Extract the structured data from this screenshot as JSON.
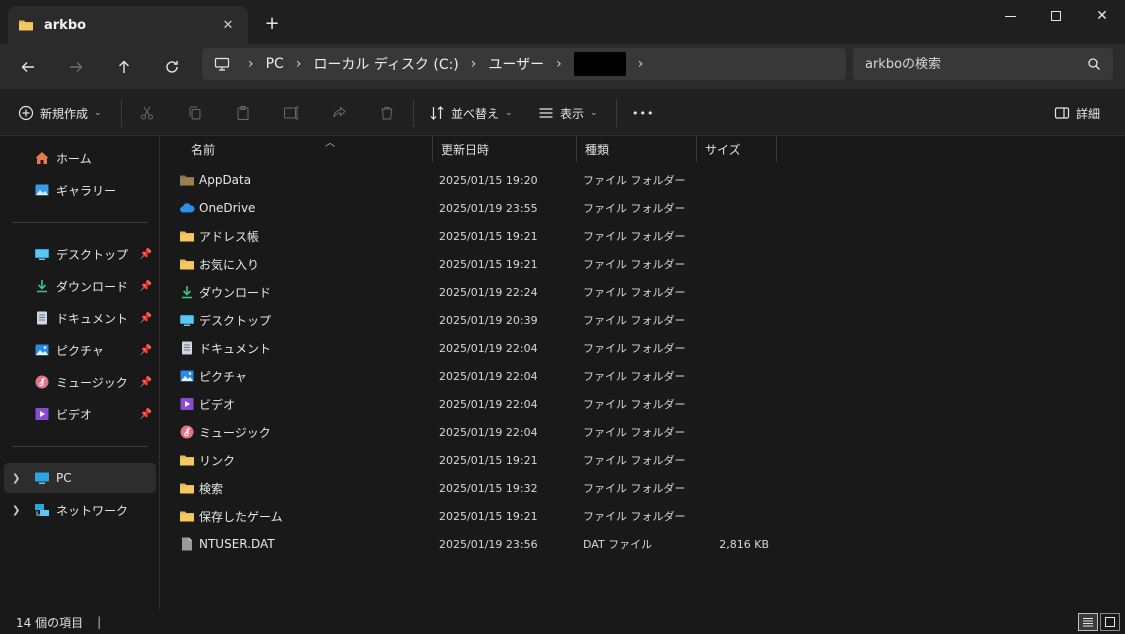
{
  "window": {
    "tab_title": "arkbo",
    "new_tab": "+",
    "close_tab": "✕",
    "minimize": "—",
    "maximize": "☐",
    "close": "✕"
  },
  "address": {
    "crumbs": [
      "PC",
      "ローカル ディスク (C:)",
      "ユーザー"
    ],
    "search_placeholder": "arkboの検索"
  },
  "toolbar": {
    "new_label": "新規作成",
    "sort_label": "並べ替え",
    "view_label": "表示",
    "more_label": "•••",
    "details_label": "詳細"
  },
  "nav": {
    "quick": [
      {
        "label": "ホーム",
        "icon": "home-icon"
      },
      {
        "label": "ギャラリー",
        "icon": "gallery-icon"
      }
    ],
    "pinned": [
      {
        "label": "デスクトップ",
        "icon": "desktop-icon"
      },
      {
        "label": "ダウンロード",
        "icon": "download-icon"
      },
      {
        "label": "ドキュメント",
        "icon": "document-icon"
      },
      {
        "label": "ピクチャ",
        "icon": "pictures-icon"
      },
      {
        "label": "ミュージック",
        "icon": "music-icon"
      },
      {
        "label": "ビデオ",
        "icon": "video-icon"
      }
    ],
    "tree": [
      {
        "label": "PC",
        "icon": "pc-icon"
      },
      {
        "label": "ネットワーク",
        "icon": "network-icon"
      }
    ]
  },
  "columns": {
    "name": "名前",
    "modified": "更新日時",
    "type": "種類",
    "size": "サイズ"
  },
  "files": [
    {
      "name": "AppData",
      "modified": "2025/01/15 19:20",
      "type": "ファイル フォルダー",
      "size": "",
      "icon": "folder-dim-icon"
    },
    {
      "name": "OneDrive",
      "modified": "2025/01/19 23:55",
      "type": "ファイル フォルダー",
      "size": "",
      "icon": "onedrive-icon"
    },
    {
      "name": "アドレス帳",
      "modified": "2025/01/15 19:21",
      "type": "ファイル フォルダー",
      "size": "",
      "icon": "folder-icon"
    },
    {
      "name": "お気に入り",
      "modified": "2025/01/15 19:21",
      "type": "ファイル フォルダー",
      "size": "",
      "icon": "folder-icon"
    },
    {
      "name": "ダウンロード",
      "modified": "2025/01/19 22:24",
      "type": "ファイル フォルダー",
      "size": "",
      "icon": "download-icon"
    },
    {
      "name": "デスクトップ",
      "modified": "2025/01/19 20:39",
      "type": "ファイル フォルダー",
      "size": "",
      "icon": "desktop-icon"
    },
    {
      "name": "ドキュメント",
      "modified": "2025/01/19 22:04",
      "type": "ファイル フォルダー",
      "size": "",
      "icon": "document-icon"
    },
    {
      "name": "ピクチャ",
      "modified": "2025/01/19 22:04",
      "type": "ファイル フォルダー",
      "size": "",
      "icon": "pictures-icon"
    },
    {
      "name": "ビデオ",
      "modified": "2025/01/19 22:04",
      "type": "ファイル フォルダー",
      "size": "",
      "icon": "video-icon"
    },
    {
      "name": "ミュージック",
      "modified": "2025/01/19 22:04",
      "type": "ファイル フォルダー",
      "size": "",
      "icon": "music-icon"
    },
    {
      "name": "リンク",
      "modified": "2025/01/15 19:21",
      "type": "ファイル フォルダー",
      "size": "",
      "icon": "folder-icon"
    },
    {
      "name": "検索",
      "modified": "2025/01/15 19:32",
      "type": "ファイル フォルダー",
      "size": "",
      "icon": "folder-icon"
    },
    {
      "name": "保存したゲーム",
      "modified": "2025/01/15 19:21",
      "type": "ファイル フォルダー",
      "size": "",
      "icon": "folder-icon"
    },
    {
      "name": "NTUSER.DAT",
      "modified": "2025/01/19 23:56",
      "type": "DAT ファイル",
      "size": "2,816 KB",
      "icon": "file-icon"
    }
  ],
  "status": {
    "count": "14 個の項目",
    "cursor": "|"
  },
  "colors": {
    "folder": "#e8b64a",
    "accent": "#4cc2ff",
    "onedrive": "#2d8fe5"
  }
}
